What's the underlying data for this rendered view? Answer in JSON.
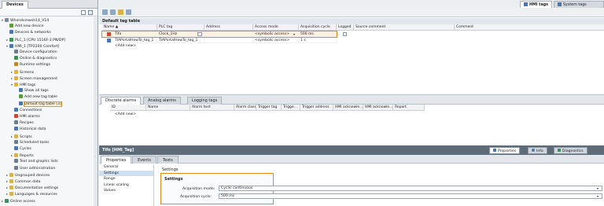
{
  "left_panel": {
    "tab": "Devices",
    "tree": [
      {
        "label": "Wherelsmwsh14_V14",
        "level": 0,
        "exp": "▾",
        "color": "#7a8a99"
      },
      {
        "label": "Add new device",
        "level": 1,
        "exp": "",
        "color": "#5a9e3a"
      },
      {
        "label": "Devices & networks",
        "level": 1,
        "exp": "",
        "color": "#4b76b0"
      },
      {
        "label": "PLC_1 [CPU 1516F-3 PN/DP]",
        "level": 1,
        "exp": "▸",
        "color": "#3f8f5a"
      },
      {
        "label": "HMI_1 [TP2200 Comfort]",
        "level": 1,
        "exp": "▾",
        "color": "#4b76b0"
      },
      {
        "label": "Device configuration",
        "level": 2,
        "exp": "",
        "color": "#6d7d8d"
      },
      {
        "label": "Online & diagnostics",
        "level": 2,
        "exp": "",
        "color": "#3f8f5a"
      },
      {
        "label": "Runtime settings",
        "level": 2,
        "exp": "",
        "color": "#c08a2b"
      },
      {
        "label": "Screens",
        "level": 2,
        "exp": "▸",
        "color": "#d9b24a"
      },
      {
        "label": "Screen management",
        "level": 2,
        "exp": "▸",
        "color": "#d9b24a"
      },
      {
        "label": "HMI tags",
        "level": 2,
        "exp": "▾",
        "color": "#d9b24a"
      },
      {
        "label": "Show all tags",
        "level": 3,
        "exp": "",
        "color": "#4b76b0"
      },
      {
        "label": "Add new tag table",
        "level": 3,
        "exp": "",
        "color": "#5a9e3a"
      },
      {
        "label": "Default tag table [3]",
        "level": 3,
        "exp": "",
        "color": "#4b76b0",
        "selected": true
      },
      {
        "label": "Connections",
        "level": 2,
        "exp": "",
        "color": "#4b76b0"
      },
      {
        "label": "HMI alarms",
        "level": 2,
        "exp": "",
        "color": "#c94a3a"
      },
      {
        "label": "Recipes",
        "level": 2,
        "exp": "",
        "color": "#6d7d8d"
      },
      {
        "label": "Historical data",
        "level": 2,
        "exp": "",
        "color": "#4b76b0"
      },
      {
        "label": "Scripts",
        "level": 2,
        "exp": "▸",
        "color": "#d9b24a"
      },
      {
        "label": "Scheduled tasks",
        "level": 2,
        "exp": "",
        "color": "#6d7d8d"
      },
      {
        "label": "Cycles",
        "level": 2,
        "exp": "",
        "color": "#4b76b0"
      },
      {
        "label": "Reports",
        "level": 2,
        "exp": "▸",
        "color": "#d9b24a"
      },
      {
        "label": "Text and graphic lists",
        "level": 2,
        "exp": "",
        "color": "#6d7d8d"
      },
      {
        "label": "User administration",
        "level": 2,
        "exp": "",
        "color": "#6d7d8d"
      },
      {
        "label": "Ungrouped devices",
        "level": 1,
        "exp": "▸",
        "color": "#d9b24a"
      },
      {
        "label": "Common data",
        "level": 1,
        "exp": "▸",
        "color": "#d9b24a"
      },
      {
        "label": "Documentation settings",
        "level": 1,
        "exp": "▸",
        "color": "#d9b24a"
      },
      {
        "label": "Languages & resources",
        "level": 1,
        "exp": "▸",
        "color": "#d9b24a"
      },
      {
        "label": "Online access",
        "level": 0,
        "exp": "▸",
        "color": "#3f8f5a"
      }
    ]
  },
  "top_tabs": {
    "hmi_tags": "HMI tags",
    "system_tags": "System tags"
  },
  "table": {
    "title": "Default tag table",
    "columns": [
      "Name ▲",
      "PLC tag",
      "Address",
      "Access mode",
      "Acquisition cycle",
      "Logged",
      "Source comment",
      "Comment"
    ],
    "rows": [
      {
        "name": "Tifo",
        "plc_tag": "Clock_1Hz",
        "address": "",
        "access": "<symbolic access>",
        "cycle": "500 ms",
        "selected": true
      },
      {
        "name": "TIAPortalHowTo_tag_1",
        "plc_tag": "TIAPortalHowTo_tag_1",
        "address": "",
        "access": "<symbolic access>",
        "cycle": "1 s",
        "selected": false
      }
    ],
    "add_new": "<Add new>"
  },
  "alarms": {
    "tabs": [
      "Discrete alarms",
      "Analog alarms",
      "Logging tags"
    ],
    "columns": [
      "ID",
      "Name",
      "Alarm text",
      "Alarm class",
      "Trigger tag",
      "Trigge...",
      "Trigger address",
      "HMI acknowle...",
      "HMI acknowle...",
      "Report"
    ],
    "add_new": "<Add new>"
  },
  "inspector": {
    "title": "Tifo [HMI_Tag]",
    "right_tabs": [
      "Properties",
      "Info",
      "Diagnostics"
    ],
    "sub_tabs": [
      "Properties",
      "Events",
      "Texts"
    ],
    "nav": [
      "General",
      "Settings",
      "Range",
      "Linear scaling",
      "Values"
    ],
    "group_title": "Settings",
    "section_title": "Settings",
    "acq_mode_label": "Acquisition mode:",
    "acq_mode_value": "Cyclic continuous",
    "acq_cycle_label": "Acquisition cycle:",
    "acq_cycle_value": "500 ms"
  }
}
